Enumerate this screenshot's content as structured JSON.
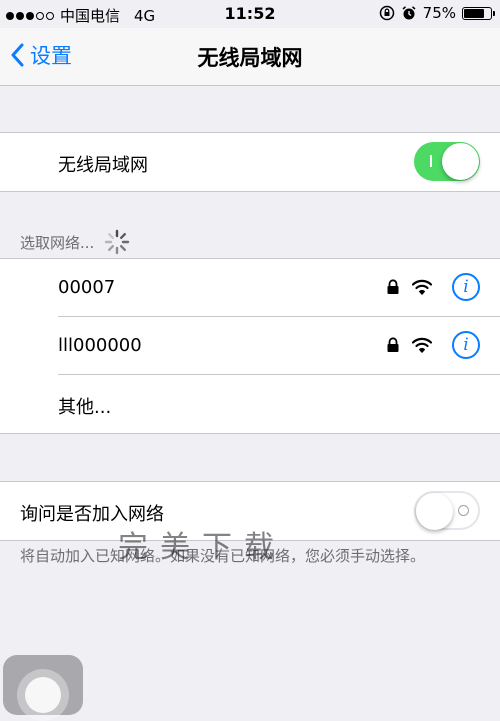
{
  "status_bar": {
    "carrier": "中国电信",
    "network": "4G",
    "time": "11:52",
    "battery": "75%",
    "battery_level": 0.75
  },
  "nav": {
    "back_label": "设置",
    "title": "无线局域网"
  },
  "wifi_toggle": {
    "label": "无线局域网",
    "on": true
  },
  "networks_section": {
    "header": "选取网络..."
  },
  "networks": [
    {
      "name": "00007",
      "locked": true
    },
    {
      "name": "lll000000",
      "locked": true
    }
  ],
  "other": {
    "label": "其他..."
  },
  "ask_join": {
    "label": "询问是否加入网络",
    "on": false,
    "note": "将自动加入已知网络。如果没有已知网络，您必须手动选择。"
  },
  "watermark": "完美下载",
  "colors": {
    "accent": "#0a7cff",
    "toggle_on": "#4cd964"
  }
}
